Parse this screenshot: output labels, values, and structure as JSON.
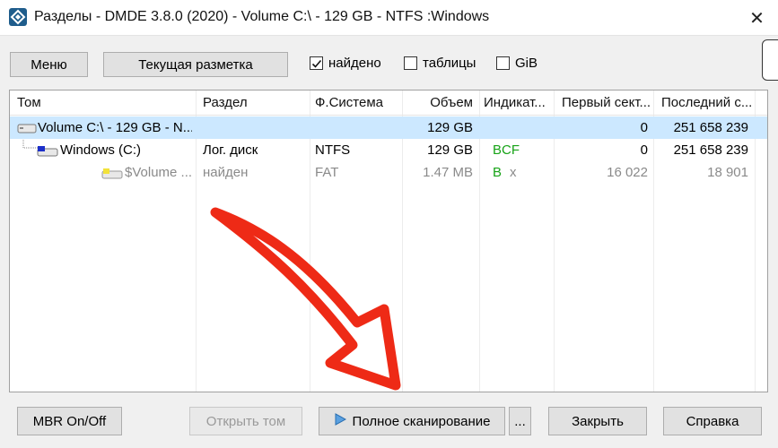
{
  "window": {
    "title": "Разделы - DMDE 3.8.0 (2020) - Volume C:\\ - 129 GB - NTFS :Windows",
    "close_glyph": "✕"
  },
  "toolbar": {
    "menu_label": "Меню",
    "layout_label": "Текущая разметка",
    "checkboxes": [
      {
        "label": "найдено",
        "checked": true
      },
      {
        "label": "таблицы",
        "checked": false
      },
      {
        "label": "GiB",
        "checked": false
      }
    ]
  },
  "table": {
    "columns": [
      "Том",
      "Раздел",
      "Ф.Система",
      "Объем",
      "Индикат...",
      "Первый сект...",
      "Последний с..."
    ],
    "rows": [
      {
        "volume": "Volume C:\\ - 129 GB - N...",
        "partition": "",
        "fs": "",
        "size": "129 GB",
        "indicator": "",
        "first": "0",
        "last": "251 658 239",
        "selected": true,
        "icon": "disk-icon"
      },
      {
        "volume": "Windows (C:)",
        "partition": "Лог. диск",
        "fs": "NTFS",
        "size": "129 GB",
        "indicator": "BCF",
        "first": "0",
        "last": "251 658 239",
        "selected": false,
        "icon": "partition-icon"
      },
      {
        "volume": "$Volume ...",
        "partition": "найден",
        "fs": "FAT",
        "size": "1.47 MB",
        "indicator": "B",
        "indicator_extra": "x",
        "first": "16 022",
        "last": "18 901",
        "selected": false,
        "icon": "found-volume-icon"
      }
    ]
  },
  "bottom": {
    "mbr_label": "MBR On/Off",
    "open_label": "Открыть том",
    "scan_label": "Полное сканирование",
    "more_label": "...",
    "close_label": "Закрыть",
    "help_label": "Справка"
  },
  "colors": {
    "selection": "#cce8ff",
    "indicator_green": "#17a317",
    "arrow_red": "#ee2a16"
  }
}
